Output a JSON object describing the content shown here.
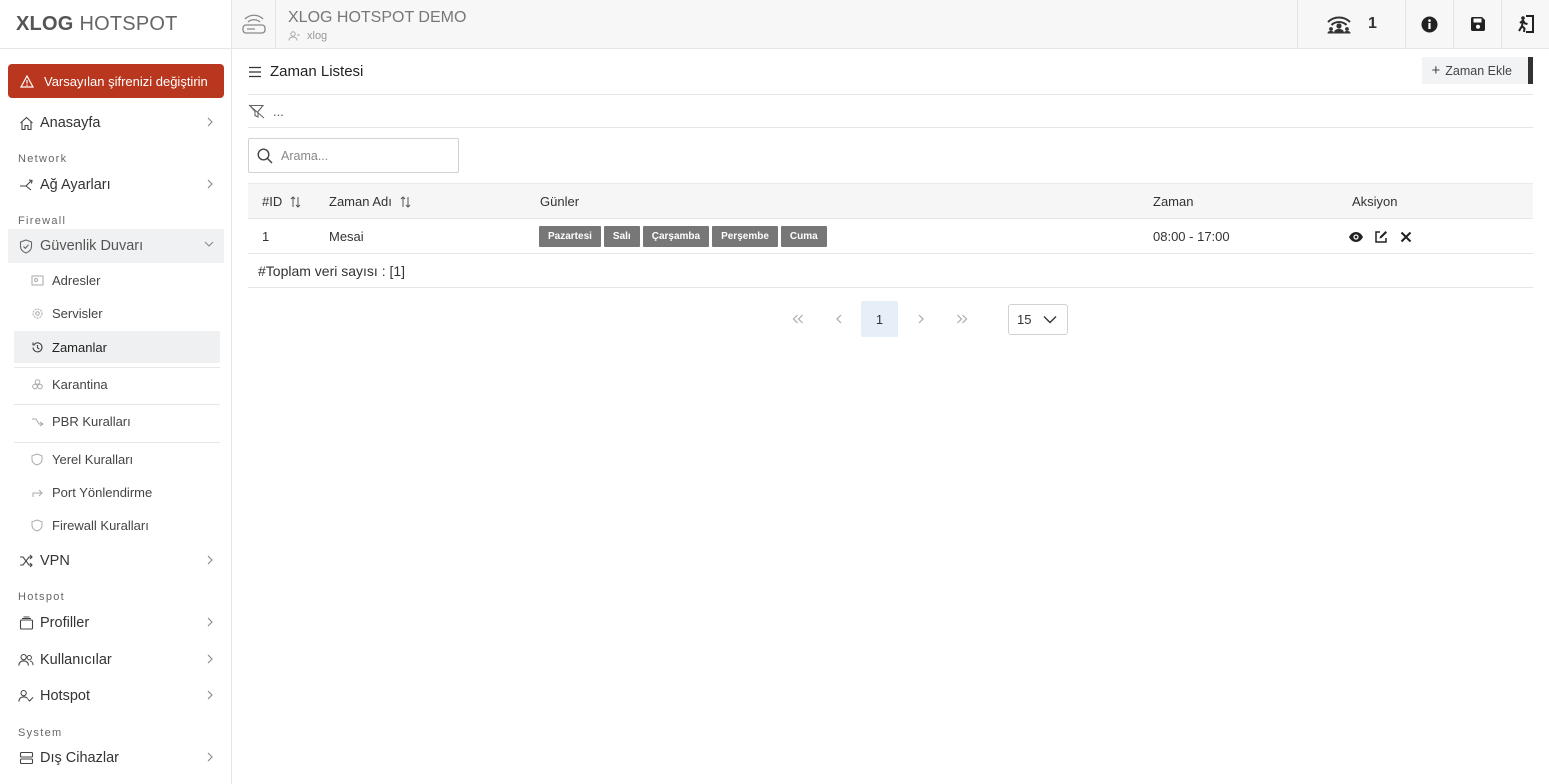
{
  "brand": {
    "bold": "XLOG",
    "rest": "HOTSPOT"
  },
  "alert": {
    "text": "Varsayılan şifrenizi değiştirin"
  },
  "sidebar": {
    "home": "Anasayfa",
    "sections": {
      "network": "Network",
      "firewall": "Firewall",
      "hotspot": "Hotspot",
      "system": "System"
    },
    "network_settings": "Ağ Ayarları",
    "firewall_menu": "Güvenlik Duvarı",
    "firewall_items": [
      "Adresler",
      "Servisler",
      "Zamanlar",
      "Karantina",
      "PBR Kuralları",
      "Yerel Kuralları",
      "Port Yönlendirme",
      "Firewall Kuralları"
    ],
    "vpn": "VPN",
    "profiles": "Profiller",
    "users": "Kullanıcılar",
    "hotspot": "Hotspot",
    "external_devices": "Dış Cihazlar"
  },
  "header": {
    "title": "XLOG HOTSPOT DEMO",
    "user": "xlog",
    "online_count": "1"
  },
  "page": {
    "title": "Zaman Listesi",
    "add_button": "Zaman Ekle",
    "filter_text": "...",
    "search_placeholder": "Arama..."
  },
  "table": {
    "columns": {
      "id": "#ID",
      "name": "Zaman Adı",
      "days": "Günler",
      "time": "Zaman",
      "action": "Aksiyon"
    },
    "rows": [
      {
        "id": "1",
        "name": "Mesai",
        "days": [
          "Pazartesi",
          "Salı",
          "Çarşamba",
          "Perşembe",
          "Cuma"
        ],
        "time": "08:00 - 17:00"
      }
    ],
    "total": "#Toplam veri sayısı : [1]"
  },
  "pagination": {
    "current": "1",
    "page_size": "15"
  },
  "colors": {
    "alert": "#b9371f",
    "day_badge": "#777777",
    "active_page": "#e6eef7"
  }
}
